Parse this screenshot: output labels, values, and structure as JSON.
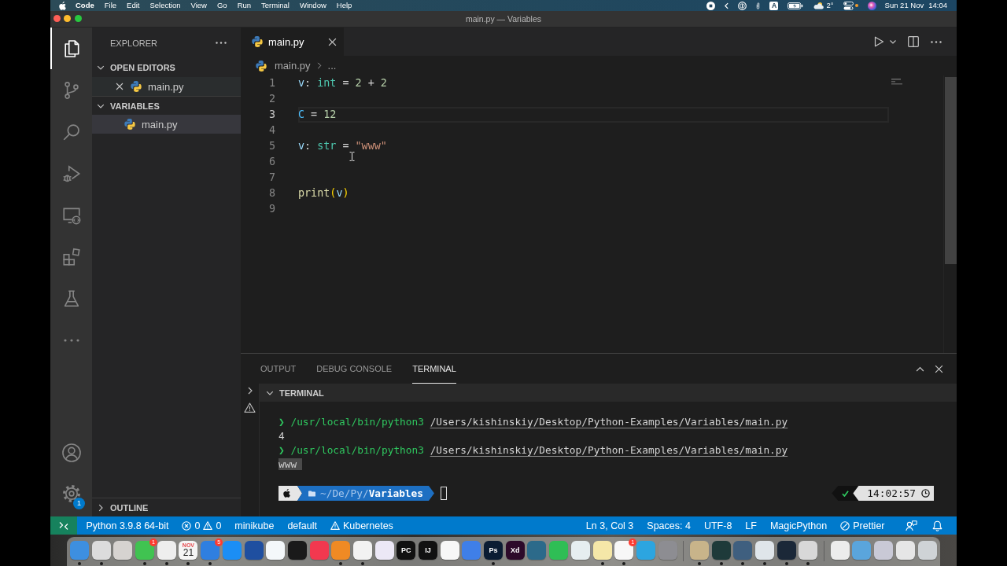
{
  "menu_bar": {
    "app": "Code",
    "menus": [
      "File",
      "Edit",
      "Selection",
      "View",
      "Go",
      "Run",
      "Terminal",
      "Window",
      "Help"
    ],
    "input_source": "A",
    "temperature": "2°",
    "date": "Sun 21 Nov",
    "time": "14:04"
  },
  "window": {
    "title": "main.py — Variables"
  },
  "activity_bar": {
    "items": [
      {
        "kind": "explorer",
        "selected": true
      },
      {
        "kind": "source-control",
        "selected": false
      },
      {
        "kind": "search",
        "selected": false
      },
      {
        "kind": "debug",
        "selected": false
      },
      {
        "kind": "remote",
        "selected": false
      },
      {
        "kind": "extensions",
        "selected": false
      },
      {
        "kind": "testing",
        "selected": false
      },
      {
        "kind": "more",
        "selected": false
      }
    ],
    "bottom": [
      {
        "kind": "account"
      },
      {
        "kind": "settings",
        "badge": "1"
      }
    ]
  },
  "sidebar": {
    "title": "EXPLORER",
    "sections": [
      {
        "kind": "open-editors",
        "title": "OPEN EDITORS",
        "expanded": true,
        "items": [
          {
            "label": "main.py",
            "selected": false,
            "hovered": true
          }
        ]
      },
      {
        "kind": "folder",
        "title": "VARIABLES",
        "expanded": true,
        "items": [
          {
            "label": "main.py",
            "selected": true
          }
        ]
      }
    ],
    "outline": {
      "title": "OUTLINE",
      "expanded": false
    }
  },
  "editor": {
    "tabs": [
      {
        "label": "main.py",
        "selected": true
      }
    ],
    "breadcrumb": [
      "main.py",
      "..."
    ],
    "lines": [
      {
        "number": "1",
        "current": false,
        "tokens": [
          {
            "text": "v",
            "kind": "variable"
          },
          {
            "text": ": ",
            "kind": "plain"
          },
          {
            "text": "int",
            "kind": "type"
          },
          {
            "text": " = ",
            "kind": "plain"
          },
          {
            "text": "2",
            "kind": "number"
          },
          {
            "text": " + ",
            "kind": "plain"
          },
          {
            "text": "2",
            "kind": "number"
          }
        ]
      },
      {
        "number": "2",
        "current": false
      },
      {
        "number": "3",
        "current": true,
        "tokens": [
          {
            "text": "C",
            "kind": "constant"
          },
          {
            "text": " = ",
            "kind": "plain"
          },
          {
            "text": "12",
            "kind": "number"
          }
        ]
      },
      {
        "number": "4",
        "current": false
      },
      {
        "number": "5",
        "current": false,
        "tokens": [
          {
            "text": "v",
            "kind": "variable"
          },
          {
            "text": ": ",
            "kind": "plain"
          },
          {
            "text": "str",
            "kind": "type"
          },
          {
            "text": " = ",
            "kind": "plain"
          },
          {
            "text": "\"www\"",
            "kind": "string"
          }
        ]
      },
      {
        "number": "6",
        "current": false
      },
      {
        "number": "7",
        "current": false
      },
      {
        "number": "8",
        "current": false,
        "tokens": [
          {
            "text": "print",
            "kind": "function"
          },
          {
            "text": "(",
            "kind": "bracket"
          },
          {
            "text": "v",
            "kind": "variable"
          },
          {
            "text": ")",
            "kind": "bracket"
          }
        ]
      },
      {
        "number": "9",
        "current": false
      }
    ]
  },
  "panel": {
    "tabs": [
      {
        "label": "OUTPUT",
        "selected": false
      },
      {
        "label": "DEBUG CONSOLE",
        "selected": false
      },
      {
        "label": "TERMINAL",
        "selected": true
      }
    ],
    "terminal": {
      "title": "TERMINAL",
      "expanded": true,
      "lines": [
        {
          "kind": "command",
          "prompt": "❯",
          "interpreter": "/usr/local/bin/python3",
          "script": "/Users/kishinskiy/Desktop/Python-Examples/Variables/main.py"
        },
        {
          "kind": "output",
          "text": "4",
          "selected": false
        },
        {
          "kind": "command",
          "prompt": "❯",
          "interpreter": "/usr/local/bin/python3",
          "script": "/Users/kishinskiy/Desktop/Python-Examples/Variables/main.py"
        },
        {
          "kind": "output",
          "text": "www",
          "selected": true
        }
      ],
      "prompt": {
        "path": "~/De/Py/**Variables**"
      },
      "last_ok": true,
      "time": "14:02:57"
    }
  },
  "status_bar": {
    "left": [
      {
        "kind": "text",
        "label": "Python 3.9.8 64-bit"
      },
      {
        "kind": "problems",
        "errors": "0",
        "warnings": "0"
      },
      {
        "kind": "text",
        "label": "minikube"
      },
      {
        "kind": "text",
        "label": "default"
      },
      {
        "kind": "warning",
        "label": "Kubernetes"
      }
    ],
    "right": [
      {
        "kind": "text",
        "label": "Ln 3, Col 3"
      },
      {
        "kind": "text",
        "label": "Spaces: 4"
      },
      {
        "kind": "text",
        "label": "UTF-8"
      },
      {
        "kind": "text",
        "label": "LF"
      },
      {
        "kind": "text",
        "label": "MagicPython"
      },
      {
        "kind": "blocked",
        "label": "Prettier"
      },
      {
        "kind": "feedback"
      },
      {
        "kind": "bell"
      }
    ]
  },
  "dock": {
    "items": [
      {
        "kind": "app",
        "color": "#3d8fe0",
        "running": true
      },
      {
        "kind": "app",
        "color": "#dcdcdc",
        "running": true
      },
      {
        "kind": "app",
        "color": "#d6d3d0",
        "running": false
      },
      {
        "kind": "app",
        "color": "#40c351",
        "running": true,
        "badge": "1"
      },
      {
        "kind": "app",
        "color": "#eeeeee",
        "running": true
      },
      {
        "kind": "app",
        "color": "#f5f5f5",
        "running": true,
        "caption": "NOV",
        "label": "21"
      },
      {
        "kind": "app",
        "color": "#2f7fe0",
        "running": true,
        "badge": "5"
      },
      {
        "kind": "app",
        "color": "#1b8ef5",
        "running": false
      },
      {
        "kind": "app",
        "color": "#1f4fa0",
        "running": false
      },
      {
        "kind": "app",
        "color": "#f4f8fa",
        "running": false
      },
      {
        "kind": "app",
        "color": "#1a1a1a",
        "running": false
      },
      {
        "kind": "app",
        "color": "#f2384f",
        "running": false
      },
      {
        "kind": "app",
        "color": "#f08a24",
        "running": true
      },
      {
        "kind": "app",
        "color": "#f2f2f2",
        "running": true
      },
      {
        "kind": "app",
        "color": "#ece8f6",
        "running": false
      },
      {
        "kind": "app",
        "color": "#111111",
        "running": false,
        "label": "PC"
      },
      {
        "kind": "app",
        "color": "#111111",
        "running": false,
        "label": "IJ"
      },
      {
        "kind": "app",
        "color": "#f7f7f7",
        "running": false
      },
      {
        "kind": "app",
        "color": "#3f7fe8",
        "running": false
      },
      {
        "kind": "app",
        "color": "#0a1c33",
        "running": true,
        "label": "Ps"
      },
      {
        "kind": "app",
        "color": "#2d0a2a",
        "running": false,
        "label": "Xd"
      },
      {
        "kind": "app",
        "color": "#2c6a8a",
        "running": false
      },
      {
        "kind": "app",
        "color": "#2fbe55",
        "running": false
      },
      {
        "kind": "app",
        "color": "#e6eef0",
        "running": false
      },
      {
        "kind": "app",
        "color": "#f5e7a8",
        "running": true
      },
      {
        "kind": "app",
        "color": "#f7f7f7",
        "running": true,
        "badge": "1"
      },
      {
        "kind": "app",
        "color": "#2ca5e0",
        "running": false
      },
      {
        "kind": "app",
        "color": "#8d8d92",
        "running": false
      },
      {
        "kind": "separator"
      },
      {
        "kind": "app",
        "color": "#c8b48a",
        "running": true
      },
      {
        "kind": "app",
        "color": "#1e3a3a",
        "running": true
      },
      {
        "kind": "app",
        "color": "#3f5f7f",
        "running": true
      },
      {
        "kind": "app",
        "color": "#dfe5ea",
        "running": true
      },
      {
        "kind": "app",
        "color": "#1b2838",
        "running": true
      },
      {
        "kind": "app",
        "color": "#d8d8d8",
        "running": true
      },
      {
        "kind": "separator"
      },
      {
        "kind": "app",
        "color": "#ececec",
        "running": false
      },
      {
        "kind": "app",
        "color": "#5aa5dc",
        "running": false
      },
      {
        "kind": "app",
        "color": "#c9c9d6",
        "running": false
      },
      {
        "kind": "app",
        "color": "#e6e6e6",
        "running": false
      },
      {
        "kind": "app",
        "color": "#cfd3d6",
        "running": false
      }
    ]
  }
}
